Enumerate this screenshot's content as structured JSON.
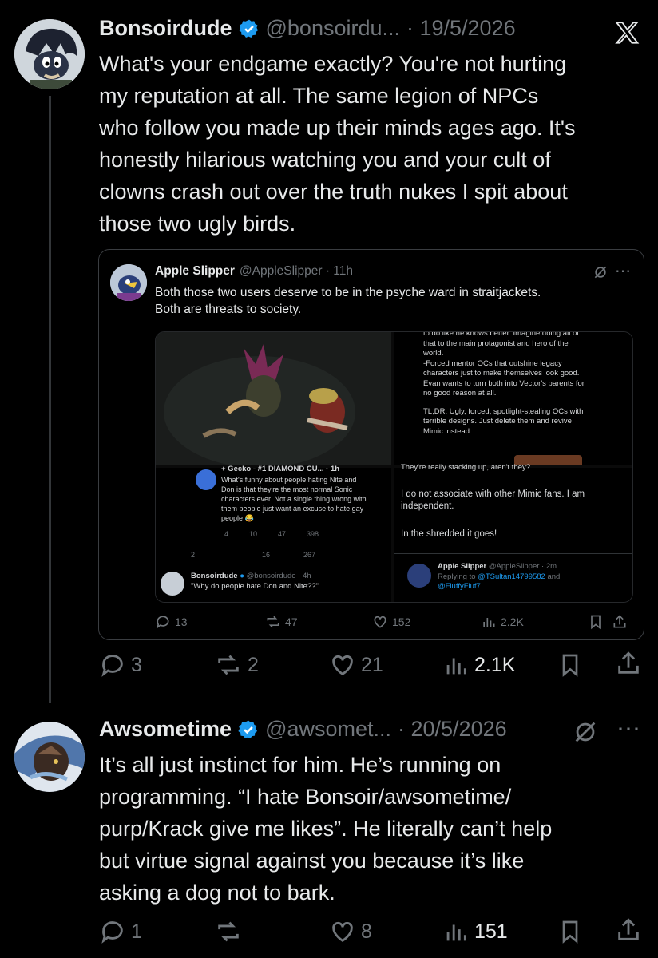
{
  "tweet1": {
    "name": "Bonsoirdude",
    "handle": "@bonsoirdu...",
    "date": "· 19/5/2026",
    "text_lines": [
      "What's your endgame exactly? You're not hurting",
      "my reputation at all. The same legion of NPCs",
      "who follow you made up their minds ages ago. It's",
      "honestly hilarious watching you and your cult of",
      "clowns crash out over the truth nukes I spit about",
      "those two ugly birds."
    ],
    "actions": {
      "replies": "3",
      "reposts": "2",
      "likes": "21",
      "views": "2.1K"
    },
    "icon": "x-logo-icon"
  },
  "quote": {
    "name": "Apple Slipper",
    "handle": "@AppleSlipper · 11h",
    "text_lines": [
      "Both those two users deserve to be in the psyche ward in straitjackets.",
      "Both are threats to society."
    ],
    "actions": {
      "replies": "13",
      "reposts": "47",
      "likes": "152",
      "views": "2.2K"
    },
    "media": {
      "right_top_lines": [
        "to do like he knows better. Imagine doing all of",
        "that to the main protagonist and hero of the",
        "world.",
        "-Forced mentor OCs that outshine legacy",
        "characters just to make themselves look good.",
        "Evan wants to turn both into Vector's parents for",
        "no good reason at all.",
        "",
        "TL;DR: Ugly, forced, spotlight-stealing OCs with",
        "terrible designs. Just delete them and revive",
        "Mimic instead."
      ],
      "left_bottom": {
        "header": "+ Gecko - #1 DIAMOND CU... · 1h",
        "lines": [
          "What's funny about people hating Nite and",
          "Don is that they're the most normal Sonic",
          "characters ever. Not a single thing wrong with",
          "them people just want an excuse to hate gay",
          "people 😂"
        ],
        "inner_actions": [
          "4",
          "10",
          "47",
          "398"
        ],
        "outer_actions": [
          "2",
          "",
          "16",
          "267"
        ],
        "reply_name": "Bonsoirdude",
        "reply_handle": "@bonsoirdude · 4h",
        "reply_text": "\"Why do people hate Don and Nite??\""
      },
      "right_bottom": {
        "cut_line": "They're really stacking up, aren't they?",
        "line1a": "I do not associate with other Mimic fans. I am",
        "line1b": "independent.",
        "line2": "In the shredded it goes!",
        "reply_name": "Apple Slipper",
        "reply_handle": "@AppleSlipper · 2m",
        "replying_prefix": "Replying to",
        "replying_to_1": "@TSultan14799582",
        "replying_and": "and",
        "replying_to_2": "@FluffyFluf7"
      }
    }
  },
  "tweet2": {
    "name": "Awsometime",
    "handle": "@awsomet...",
    "date": "· 20/5/2026",
    "text_lines": [
      "It’s all just instinct for him. He’s running on",
      "programming. “I hate Bonsoir/awsometime/",
      "purp/Krack give me likes”. He literally can’t help",
      "but virtue signal against you because it’s like",
      "asking a dog not to bark."
    ],
    "actions": {
      "replies": "1",
      "reposts": "",
      "likes": "8",
      "views": "151"
    }
  },
  "colors": {
    "background": "#000000",
    "text": "#e7e9ea",
    "secondary": "#71767b",
    "verified": "#1d9bf0"
  }
}
